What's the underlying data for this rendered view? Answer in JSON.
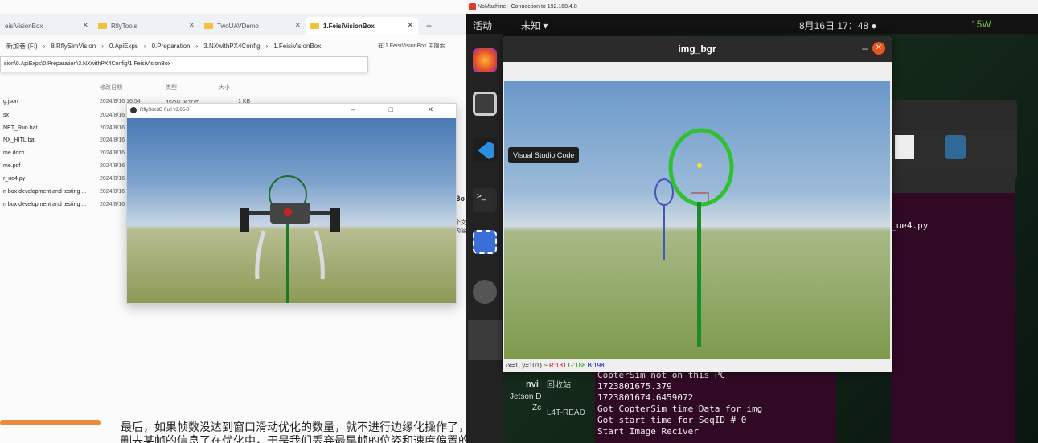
{
  "explorer": {
    "tabs": [
      {
        "label": "eisiVisionBox"
      },
      {
        "label": "RflyTools"
      },
      {
        "label": "TwoUAVDemo"
      },
      {
        "label": "1.FeisiVisionBox"
      }
    ],
    "new_tab": "+",
    "breadcrumb": [
      "新加卷 (F:)",
      "8.RflySimVision",
      "0.ApiExps",
      "0.Preparation",
      "3.NXwithPX4Config",
      "1.FeisiVisionBox"
    ],
    "search_hint": "在 1.FeisiVisionBox 中搜索",
    "path_text": "sion\\0.ApiExps\\0.Preparation\\3.NXwithPX4Config\\1.FeisiVisionBox",
    "columns": {
      "date": "修改日期",
      "type": "类型",
      "size": "大小"
    },
    "first_row": {
      "type": "JSON 源文件",
      "size": "1 KB"
    },
    "files": [
      {
        "name": "g.json",
        "date": "2024/8/16 16:54"
      },
      {
        "name": "sx",
        "date": "2024/8/16"
      },
      {
        "name": "NET_Run.bat",
        "date": "2024/8/16"
      },
      {
        "name": "NX_HITL.bat",
        "date": "2024/8/16"
      },
      {
        "name": "me.docx",
        "date": "2024/8/16"
      },
      {
        "name": "me.pdf",
        "date": "2024/8/16"
      },
      {
        "name": "r_ue4.py",
        "date": "2024/8/16"
      },
      {
        "name": "n box development and testing ...",
        "date": "2024/8/16"
      },
      {
        "name": "n box development and testing ...",
        "date": "2024/8/16"
      }
    ],
    "side_snippets": {
      "bo": "Bo",
      "ge": "个文",
      "nr": "内容"
    },
    "doc_line1": "最后，如果帧数没达到窗口滑动优化的数量，就不进行边缘化操作了，",
    "doc_line2": "删去某帧的信息了在优化中，于是我们丢弃最早帧的位姿和速度偏置的"
  },
  "rflysim": {
    "title": "RflySim3D Full v3.05-0",
    "controls": "–  □  ✕"
  },
  "nomachine": {
    "title": "NoMachine - Connection to 192.168.4.8",
    "topbar": {
      "activities": "活动",
      "app_menu": "未知 ▾",
      "clock": "8月16日 17：48 ●",
      "power": "15W"
    },
    "tooltip": "Visual Studio Code",
    "img_window": {
      "title": "img_bgr",
      "status_coords": "(x=1, y=101) ~",
      "status_r": "R:181",
      "status_g": "G:188",
      "status_b": "B:198"
    },
    "terminal_right_text": "_ue4.py",
    "terminal_lines": [
      "CopterSim not on this PC",
      "1723801675.379",
      "1723801674.6459072",
      "Got CopterSim time Data for img",
      "Got start time for SeqID # 0",
      "Start Image Reciver"
    ],
    "desktop_items": {
      "recycle": "回收站",
      "readme": "L4T-READ",
      "jetson": "Jetson D",
      "nv": "nvi",
      "zc": "Zc"
    }
  }
}
